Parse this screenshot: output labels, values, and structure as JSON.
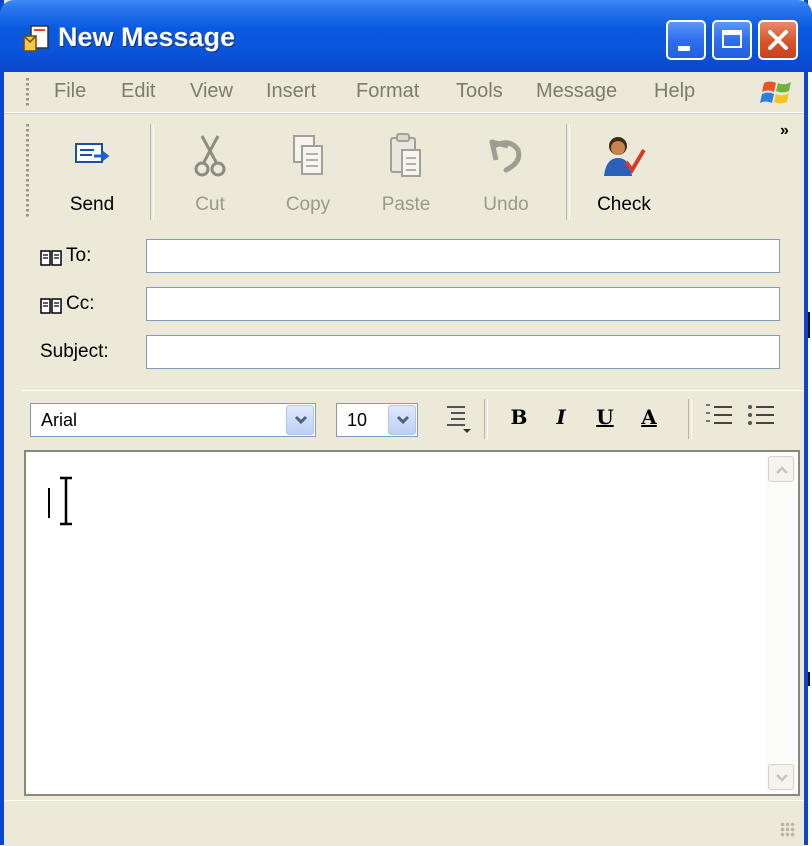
{
  "window": {
    "title": "New Message"
  },
  "menu": [
    "File",
    "Edit",
    "View",
    "Insert",
    "Format",
    "Tools",
    "Message",
    "Help"
  ],
  "toolbar": {
    "send": "Send",
    "cut": "Cut",
    "copy": "Copy",
    "paste": "Paste",
    "undo": "Undo",
    "check": "Check",
    "overflow": "»"
  },
  "header": {
    "to_label": "To:",
    "cc_label": "Cc:",
    "subject_label": "Subject:",
    "to_value": "",
    "cc_value": "",
    "subject_value": ""
  },
  "format": {
    "font": "Arial",
    "size": "10",
    "bold": "B",
    "italic": "I",
    "underline": "U",
    "font_color": "A"
  },
  "body": {
    "text": ""
  },
  "colors": {
    "titlebar": "#0a5ae0",
    "frame": "#0a46d0",
    "chrome": "#ece9d8",
    "close": "#d6542b"
  },
  "icons": [
    "new-message-icon",
    "minimize-icon",
    "maximize-icon",
    "close-icon",
    "windows-logo-icon",
    "send-icon",
    "cut-icon",
    "copy-icon",
    "paste-icon",
    "undo-icon",
    "check-names-icon",
    "address-book-icon",
    "chevron-down-icon",
    "paragraph-style-icon",
    "numbered-list-icon",
    "bulleted-list-icon",
    "scroll-up-icon",
    "scroll-down-icon"
  ]
}
